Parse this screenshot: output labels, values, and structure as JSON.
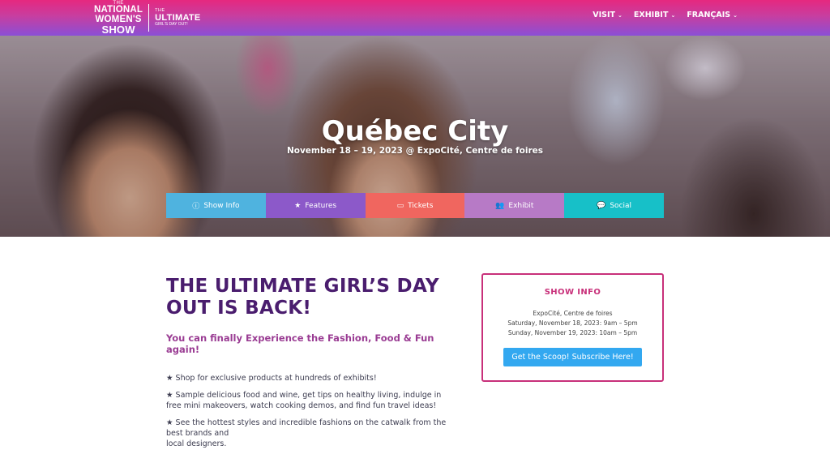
{
  "header": {
    "logo": {
      "small_top": "THE",
      "line1": "NATIONAL",
      "line2": "WOMEN'S",
      "line3": "SHOW",
      "right_small": "THE",
      "right_big": "ULTIMATE",
      "right_tag": "GIRL'S DAY OUT!"
    },
    "nav": [
      {
        "label": "VISIT",
        "icon": "chevron-down-icon"
      },
      {
        "label": "EXHIBIT",
        "icon": "chevron-down-icon"
      },
      {
        "label": "FRANÇAIS",
        "icon": "chevron-down-icon"
      }
    ],
    "gradient_colors": [
      "#e6287f",
      "#8a4fd6"
    ]
  },
  "hero": {
    "title": "Québec City",
    "subtitle": "November 18 – 19, 2023 @ ExpoCité, Centre de foires",
    "tabs": [
      {
        "label": "Show Info",
        "icon": "info-icon",
        "color": "#4fb3df"
      },
      {
        "label": "Features",
        "icon": "star-icon",
        "color": "#8c59c9"
      },
      {
        "label": "Tickets",
        "icon": "ticket-icon",
        "color": "#f0665f"
      },
      {
        "label": "Exhibit",
        "icon": "users-icon",
        "color": "#b77ac6"
      },
      {
        "label": "Social",
        "icon": "chat-icon",
        "color": "#17c0c8"
      }
    ]
  },
  "main": {
    "heading": "THE ULTIMATE GIRL’S DAY OUT IS BACK!",
    "tagline": "You can finally Experience the Fashion, Food & Fun again!",
    "bullets": [
      "★ Shop for exclusive products at hundreds of exhibits!",
      "★ Sample delicious food and wine, get tips on healthy living, indulge in free mini makeovers, watch cooking demos, and find fun travel ideas!",
      "★ See the hottest styles and incredible fashions on the catwalk from the best brands and",
      "local designers."
    ]
  },
  "show_info": {
    "title": "SHOW INFO",
    "venue": "ExpoCité, Centre de foires",
    "date1": "Saturday, November 18, 2023: 9am – 5pm",
    "date2": "Sunday, November 19, 2023: 10am – 5pm",
    "button": "Get the Scoop! Subscribe Here!"
  }
}
